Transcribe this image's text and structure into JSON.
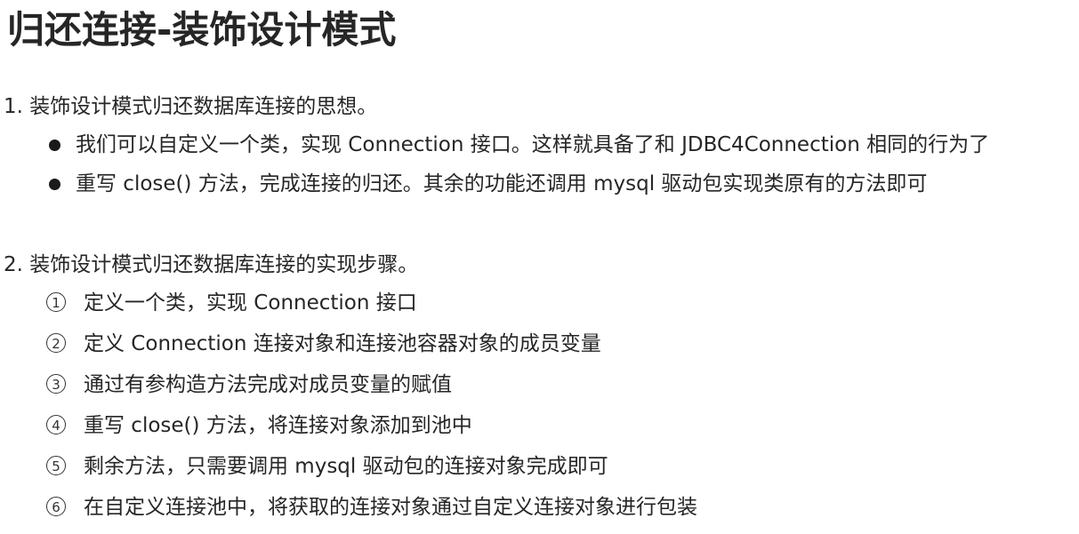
{
  "title": "归还连接-装饰设计模式",
  "section1": {
    "heading": "1. 装饰设计模式归还数据库连接的思想。",
    "bullets": [
      "我们可以自定义一个类，实现 Connection 接口。这样就具备了和 JDBC4Connection 相同的行为了",
      "重写 close() 方法，完成连接的归还。其余的功能还调用 mysql 驱动包实现类原有的方法即可"
    ]
  },
  "section2": {
    "heading": "2. 装饰设计模式归还数据库连接的实现步骤。",
    "steps": [
      {
        "num": "1",
        "text": "定义一个类，实现 Connection 接口"
      },
      {
        "num": "2",
        "text": "定义 Connection 连接对象和连接池容器对象的成员变量"
      },
      {
        "num": "3",
        "text": "通过有参构造方法完成对成员变量的赋值"
      },
      {
        "num": "4",
        "text": "重写 close() 方法，将连接对象添加到池中"
      },
      {
        "num": "5",
        "text": "剩余方法，只需要调用 mysql 驱动包的连接对象完成即可"
      },
      {
        "num": "6",
        "text": "在自定义连接池中，将获取的连接对象通过自定义连接对象进行包装"
      }
    ]
  }
}
